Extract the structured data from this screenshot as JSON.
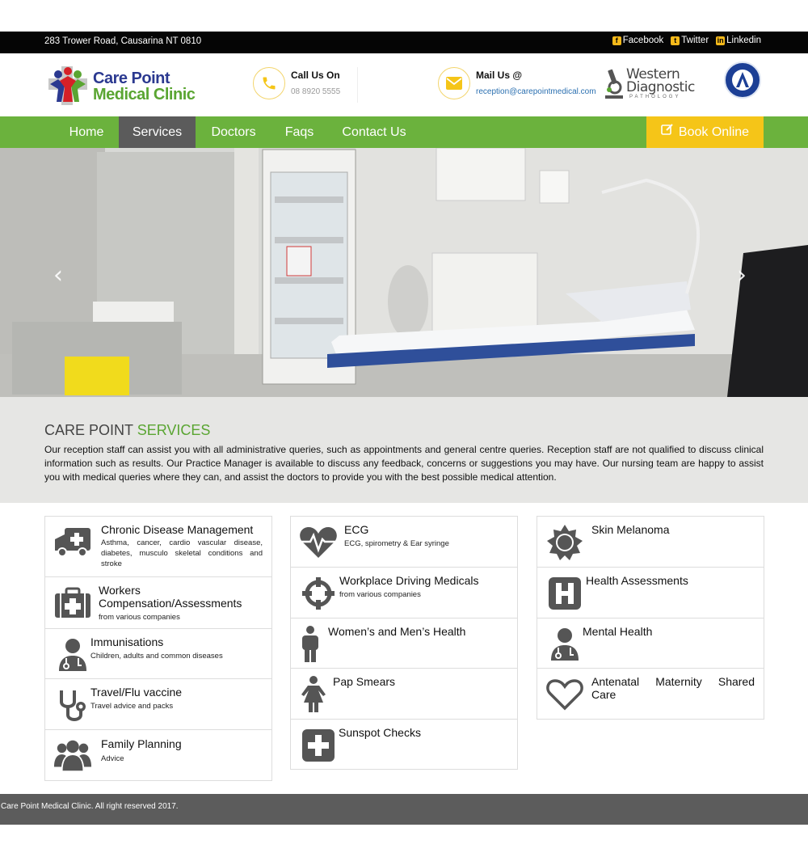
{
  "topbar": {
    "address": "283 Trower Road, Causarina NT 0810",
    "social": [
      {
        "label": "Facebook",
        "icon": "facebook-icon"
      },
      {
        "label": "Twitter",
        "icon": "twitter-icon"
      },
      {
        "label": "Linkedin",
        "icon": "linkedin-icon"
      }
    ]
  },
  "header": {
    "logo_line1": "Care Point",
    "logo_line2": "Medical Clinic",
    "call_label": "Call Us On",
    "call_value": "08 8920 5555",
    "mail_label": "Mail Us @",
    "mail_value": "reception@carepointmedical.com",
    "partner_line1": "Western",
    "partner_line2": "Diagnostic",
    "partner_line3": "PATHOLOGY"
  },
  "nav": {
    "items": [
      "Home",
      "Services",
      "Doctors",
      "Faqs",
      "Contact Us"
    ],
    "active": "Services",
    "book_label": "Book Online"
  },
  "hero": {
    "prev": "‹",
    "next": "›"
  },
  "intro": {
    "title_part1": "CARE POINT",
    "title_part2": "SERVICES",
    "text": "Our reception staff can assist you with all administrative queries, such as appointments and general centre queries. Reception staff are not qualified to discuss clinical information such as results. Our Practice Manager is available to discuss any feedback, concerns or suggestions you may have. Our nursing team are happy to assist you with medical queries where they can, and assist the doctors to provide you with the best possible medical attention."
  },
  "services": {
    "col1": [
      {
        "title": "Chronic Disease Management",
        "desc": "Asthma, cancer, cardio vascular disease, diabetes, musculo skeletal conditions and stroke",
        "icon": "ambulance-icon"
      },
      {
        "title": "Workers Compensation/Assessments",
        "desc": "from various companies",
        "icon": "medical-kit-icon"
      },
      {
        "title": "Immunisations",
        "desc": "Children, adults and common diseases",
        "icon": "doctor-icon"
      },
      {
        "title": "Travel/Flu vaccine",
        "desc": "Travel advice and packs",
        "icon": "stethoscope-icon"
      },
      {
        "title": "Family Planning",
        "desc": "Advice",
        "icon": "family-icon"
      }
    ],
    "col2": [
      {
        "title": "ECG",
        "desc": "ECG, spirometry & Ear syringe",
        "icon": "heartbeat-icon"
      },
      {
        "title": "Workplace Driving Medicals",
        "desc": "from various companies",
        "icon": "crosshair-icon"
      },
      {
        "title": "Women’s and Men’s Health",
        "desc": "",
        "icon": "male-icon"
      },
      {
        "title": "Pap Smears",
        "desc": "",
        "icon": "female-icon"
      },
      {
        "title": "Sunspot Checks",
        "desc": "",
        "icon": "plus-square-icon"
      }
    ],
    "col3": [
      {
        "title": "Skin Melanoma",
        "desc": "",
        "icon": "sun-icon"
      },
      {
        "title": "Health Assessments",
        "desc": "",
        "icon": "hospital-icon"
      },
      {
        "title": "Mental Health",
        "desc": "",
        "icon": "doctor-icon"
      },
      {
        "title": "Antenatal Maternity Shared Care",
        "desc": "",
        "icon": "heart-icon"
      }
    ]
  },
  "footer": {
    "text": "Care Point Medical Clinic. All right reserved 2017."
  },
  "colors": {
    "green": "#6bb23d",
    "yellow": "#f5c518",
    "dark": "#5b5b5b",
    "navy": "#2b3990"
  }
}
